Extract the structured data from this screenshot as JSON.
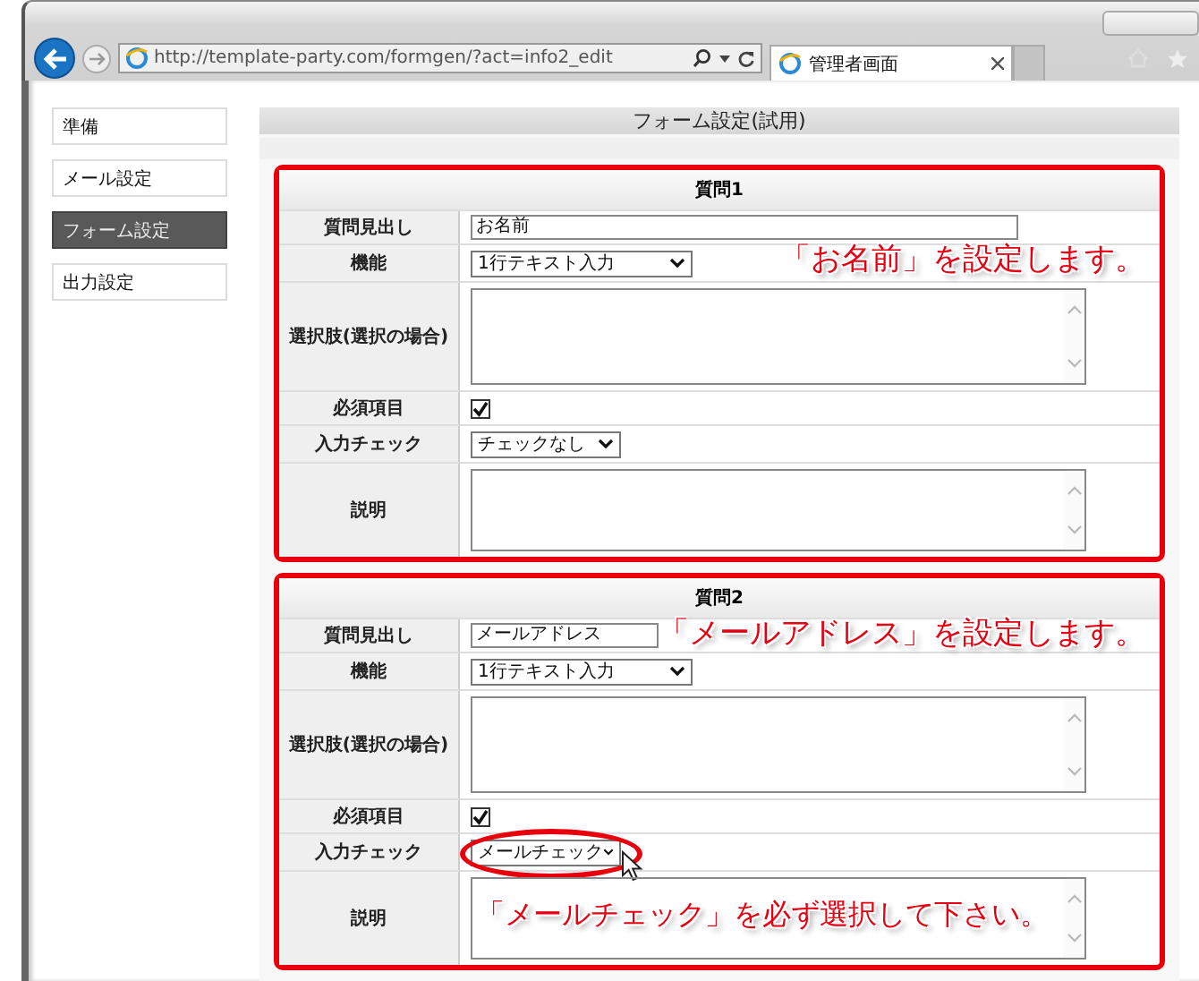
{
  "browser": {
    "url": "http://template-party.com/formgen/?act=info2_edit",
    "tab_title": "管理者画面"
  },
  "sidebar": {
    "items": [
      {
        "label": "準備",
        "selected": false
      },
      {
        "label": "メール設定",
        "selected": false
      },
      {
        "label": "フォーム設定",
        "selected": true
      },
      {
        "label": "出力設定",
        "selected": false
      }
    ]
  },
  "page": {
    "title": "フォーム設定(試用)"
  },
  "questions": [
    {
      "heading": "質問1",
      "fields": [
        {
          "kind": "text",
          "label": "質問見出し",
          "value": "お名前"
        },
        {
          "kind": "select",
          "label": "機能",
          "value": "1行テキスト入力",
          "callout": "「お名前」を設定します。"
        },
        {
          "kind": "textarea",
          "label": "選択肢(選択の場合)"
        },
        {
          "kind": "checkbox",
          "label": "必須項目",
          "checked": true
        },
        {
          "kind": "select",
          "label": "入力チェック",
          "value": "チェックなし"
        },
        {
          "kind": "textarea",
          "label": "説明"
        }
      ]
    },
    {
      "heading": "質問2",
      "fields": [
        {
          "kind": "text",
          "label": "質問見出し",
          "value": "メールアドレス",
          "callout": "「メールアドレス」を設定します。"
        },
        {
          "kind": "select",
          "label": "機能",
          "value": "1行テキスト入力"
        },
        {
          "kind": "textarea",
          "label": "選択肢(選択の場合)"
        },
        {
          "kind": "checkbox",
          "label": "必須項目",
          "checked": true
        },
        {
          "kind": "select",
          "label": "入力チェック",
          "value": "メールチェック",
          "highlighted": true,
          "pointer": true
        },
        {
          "kind": "textarea",
          "label": "説明",
          "callout": "「メールチェック」を必ず選択して下さい。"
        }
      ]
    }
  ]
}
